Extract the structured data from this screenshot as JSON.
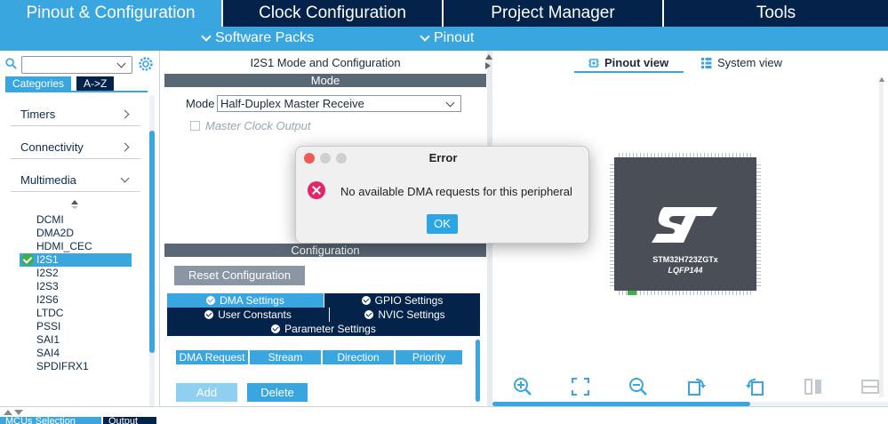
{
  "top_tabs": [
    {
      "label": "Pinout & Configuration",
      "active": true
    },
    {
      "label": "Clock Configuration"
    },
    {
      "label": "Project Manager"
    },
    {
      "label": "Tools"
    }
  ],
  "sub_bar": {
    "software_packs": "Software Packs",
    "pinout": "Pinout"
  },
  "left": {
    "search_value": "",
    "tab_categories": "Categories",
    "tab_az": "A->Z",
    "categories": [
      "Timers",
      "Connectivity",
      "Multimedia"
    ],
    "peripherals": [
      "DCMI",
      "DMA2D",
      "HDMI_CEC",
      "I2S1",
      "I2S2",
      "I2S3",
      "I2S6",
      "LTDC",
      "PSSI",
      "SAI1",
      "SAI4",
      "SPDIFRX1"
    ],
    "selected_peripheral": "I2S1"
  },
  "bottom_tabs": {
    "mcus_selection": "MCUs Selection",
    "output": "Output"
  },
  "middle": {
    "title": "I2S1 Mode and Configuration",
    "mode_header": "Mode",
    "mode_label": "Mode",
    "mode_value": "Half-Duplex Master Receive",
    "master_clock_output": "Master Clock Output",
    "configuration_header": "Configuration",
    "reset_button": "Reset Configuration",
    "settings_tabs": {
      "dma": "DMA Settings",
      "gpio": "GPIO Settings",
      "user_constants": "User Constants",
      "nvic": "NVIC Settings",
      "parameter": "Parameter Settings"
    },
    "dma_columns": [
      "DMA Request",
      "Stream",
      "Direction",
      "Priority"
    ],
    "add_button": "Add",
    "delete_button": "Delete"
  },
  "right": {
    "pinout_view": "Pinout view",
    "system_view": "System view",
    "chip_name": "STM32H723ZGTx",
    "chip_package": "LQFP144",
    "chip_logo": "ST"
  },
  "dialog": {
    "title": "Error",
    "message": "No available DMA requests for this peripheral",
    "ok": "OK"
  },
  "colors": {
    "accent": "#3aa6e0",
    "navy": "#03234b",
    "error": "#e5256a",
    "success": "#3db04b"
  }
}
